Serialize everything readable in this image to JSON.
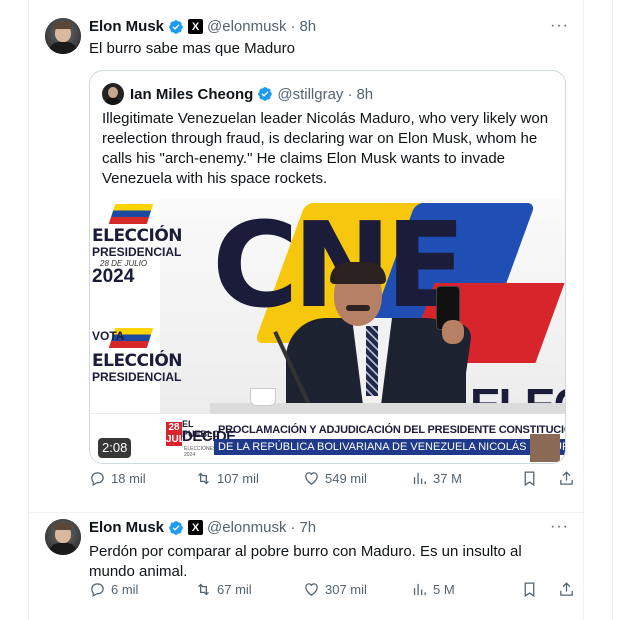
{
  "tweets": [
    {
      "name": "Elon Musk",
      "handle": "@elonmusk",
      "time": "8h",
      "text": "El burro sabe mas que Maduro",
      "quote": {
        "name": "Ian Miles Cheong",
        "handle": "@stillgray",
        "time": "8h",
        "text": "Illegitimate Venezuelan leader Nicolás Maduro, who very likely won reelection through fraud, is declaring war on Elon Musk, whom he calls his \"arch-enemy.\" He claims Elon Musk wants to invade Venezuela with his space rockets.",
        "video": {
          "duration": "2:08",
          "scene": {
            "elec1": "ELECCIÓN",
            "elec1_sub": "PRESIDENCIAL",
            "elec_date": "28 DE JULIO",
            "elec_year": "2024",
            "vota": "VOTA",
            "elec2": "ELECCIÓN",
            "elec2_sub": "PRESIDENCIAL",
            "cne": "CNE",
            "elecc": "ELECC"
          },
          "ticker": {
            "brand_top": "EL PUEBLO",
            "brand_bottom": "DECIDE",
            "brand_sub": "ELECCIONES 2024",
            "badge": "28 JUL",
            "line1": "PROCLAMACIÓN Y ADJUDICACIÓN DEL PRESIDENTE CONSTITUCIONAL",
            "line2": "DE LA REPÚBLICA BOLIVARIANA DE VENEZUELA NICOLÁS MADURO"
          }
        }
      },
      "stats": {
        "replies": "18 mil",
        "reposts": "107 mil",
        "likes": "549 mil",
        "views": "37 M"
      }
    },
    {
      "name": "Elon Musk",
      "handle": "@elonmusk",
      "time": "7h",
      "text": "Perdón por comparar al pobre burro con Maduro. Es un insulto al mundo animal.",
      "stats": {
        "replies": "6 mil",
        "reposts": "67 mil",
        "likes": "307 mil",
        "views": "5 M"
      }
    }
  ],
  "ui": {
    "dot": "·",
    "more": "···",
    "x_badge": "X"
  },
  "colors": {
    "verified": "#1d9bf0",
    "secondary_text": "#536471",
    "border": "#cfd9de"
  }
}
